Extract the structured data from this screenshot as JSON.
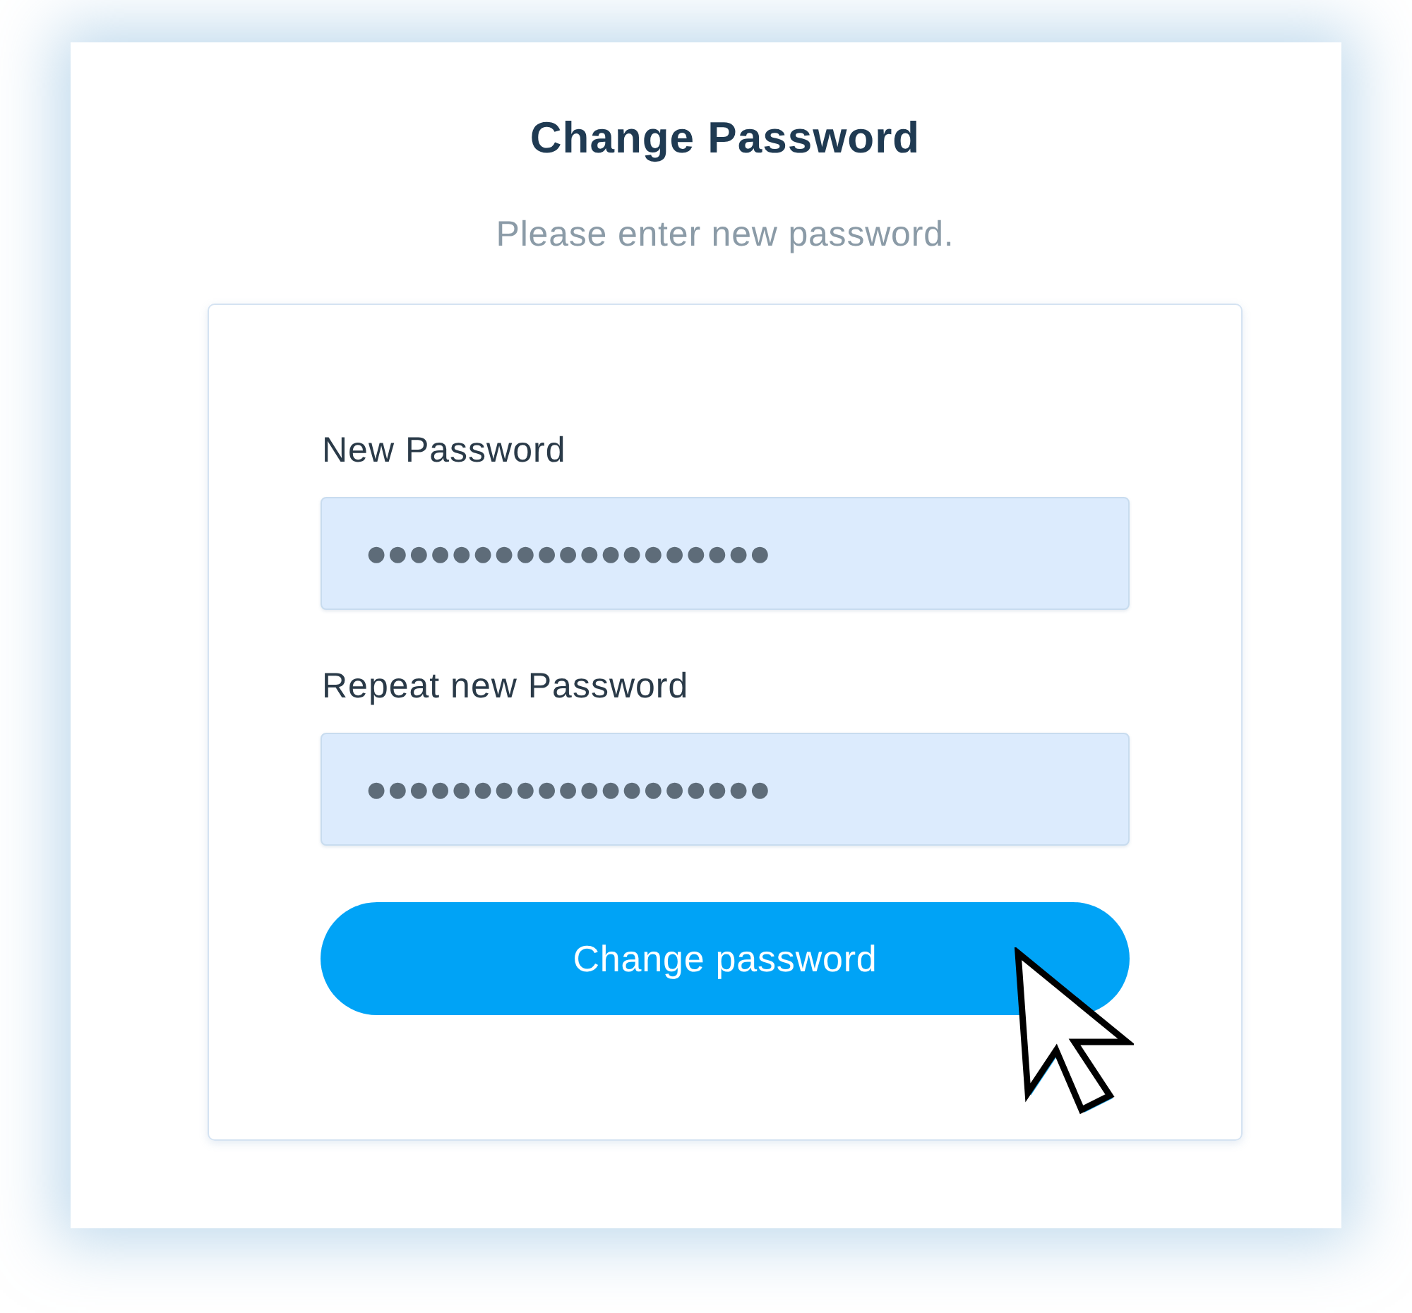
{
  "header": {
    "title": "Change Password",
    "subtitle": "Please enter new password."
  },
  "form": {
    "fields": [
      {
        "label": "New Password",
        "value": "●●●●●●●●●●●●●●●●●●●"
      },
      {
        "label": "Repeat new Password",
        "value": "●●●●●●●●●●●●●●●●●●●"
      }
    ],
    "submit_button": "Change password"
  }
}
